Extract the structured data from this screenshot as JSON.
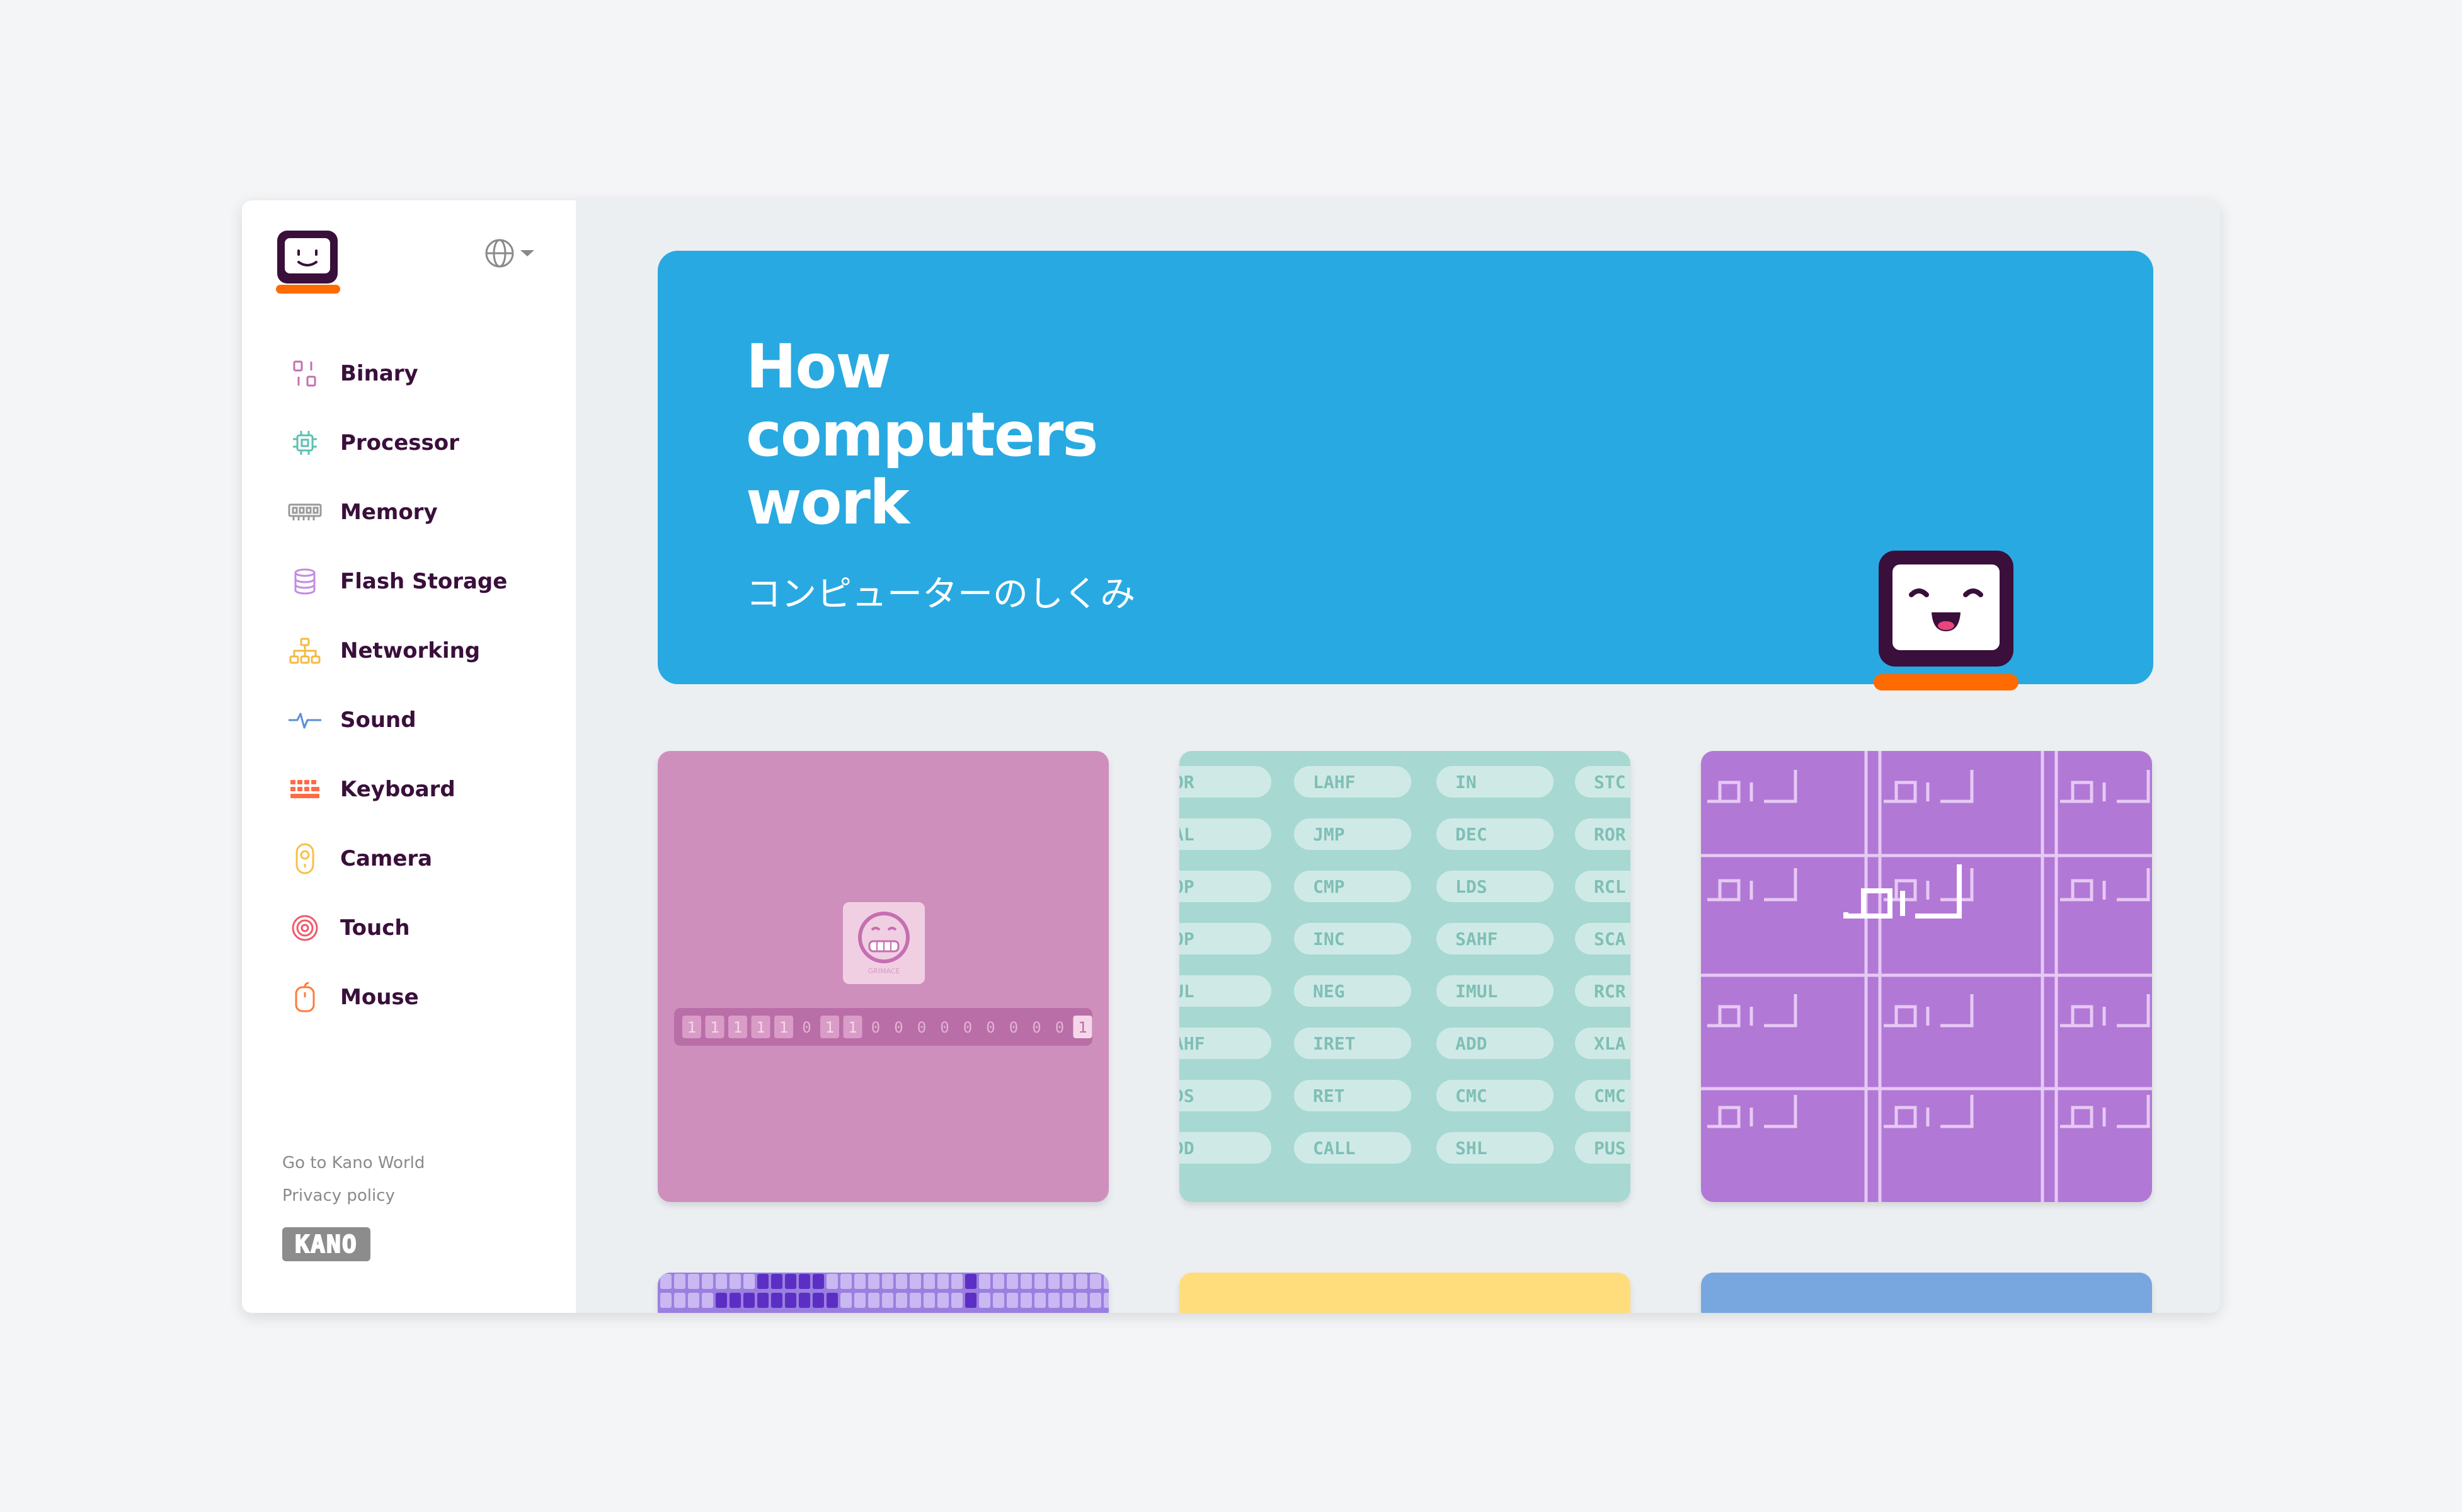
{
  "sidebar": {
    "items": [
      {
        "label": "Binary",
        "icon": "binary-icon",
        "color": "#c56fb0"
      },
      {
        "label": "Processor",
        "icon": "processor-icon",
        "color": "#5ec0b0"
      },
      {
        "label": "Memory",
        "icon": "memory-icon",
        "color": "#9a9a9a"
      },
      {
        "label": "Flash Storage",
        "icon": "flash-storage-icon",
        "color": "#c38be0"
      },
      {
        "label": "Networking",
        "icon": "networking-icon",
        "color": "#f4b942"
      },
      {
        "label": "Sound",
        "icon": "sound-icon",
        "color": "#5a8ed8"
      },
      {
        "label": "Keyboard",
        "icon": "keyboard-icon",
        "color": "#ff6b47"
      },
      {
        "label": "Camera",
        "icon": "camera-icon",
        "color": "#f6c14a"
      },
      {
        "label": "Touch",
        "icon": "touch-icon",
        "color": "#f05a6a"
      },
      {
        "label": "Mouse",
        "icon": "mouse-icon",
        "color": "#ff7a3a"
      }
    ],
    "footer": {
      "kano_world": "Go to Kano World",
      "privacy": "Privacy policy",
      "wordmark": "KANO"
    }
  },
  "hero": {
    "title": "How computers work",
    "subtitle": "コンピューターのしくみ",
    "color": "#29a9e1"
  },
  "cards": {
    "binary": {
      "color": "#cf8fbd",
      "bits": "111110110000000001",
      "emoji_caption": "GRIMACE"
    },
    "processor": {
      "color": "#a7d8d2",
      "rows": [
        [
          "OR",
          "LAHF",
          "IN",
          "STC"
        ],
        [
          "AL",
          "JMP",
          "DEC",
          "ROR"
        ],
        [
          "OP",
          "CMP",
          "LDS",
          "RCL"
        ],
        [
          "OP",
          "INC",
          "SAHF",
          "SCA"
        ],
        [
          "UL",
          "NEG",
          "IMUL",
          "RCR"
        ],
        [
          "AHF",
          "IRET",
          "ADD",
          "XLA"
        ],
        [
          "DS",
          "RET",
          "CMC",
          "CMC"
        ],
        [
          "DD",
          "CALL",
          "SHL",
          "PUS"
        ]
      ]
    },
    "memory": {
      "color": "#b278d6"
    },
    "row2": [
      {
        "color": "#9b7fe0"
      },
      {
        "color": "#ffdd7c"
      },
      {
        "color": "#78a6de"
      }
    ]
  },
  "colors": {
    "brand_dark": "#3a0f3b",
    "brand_orange": "#ff6b00"
  }
}
